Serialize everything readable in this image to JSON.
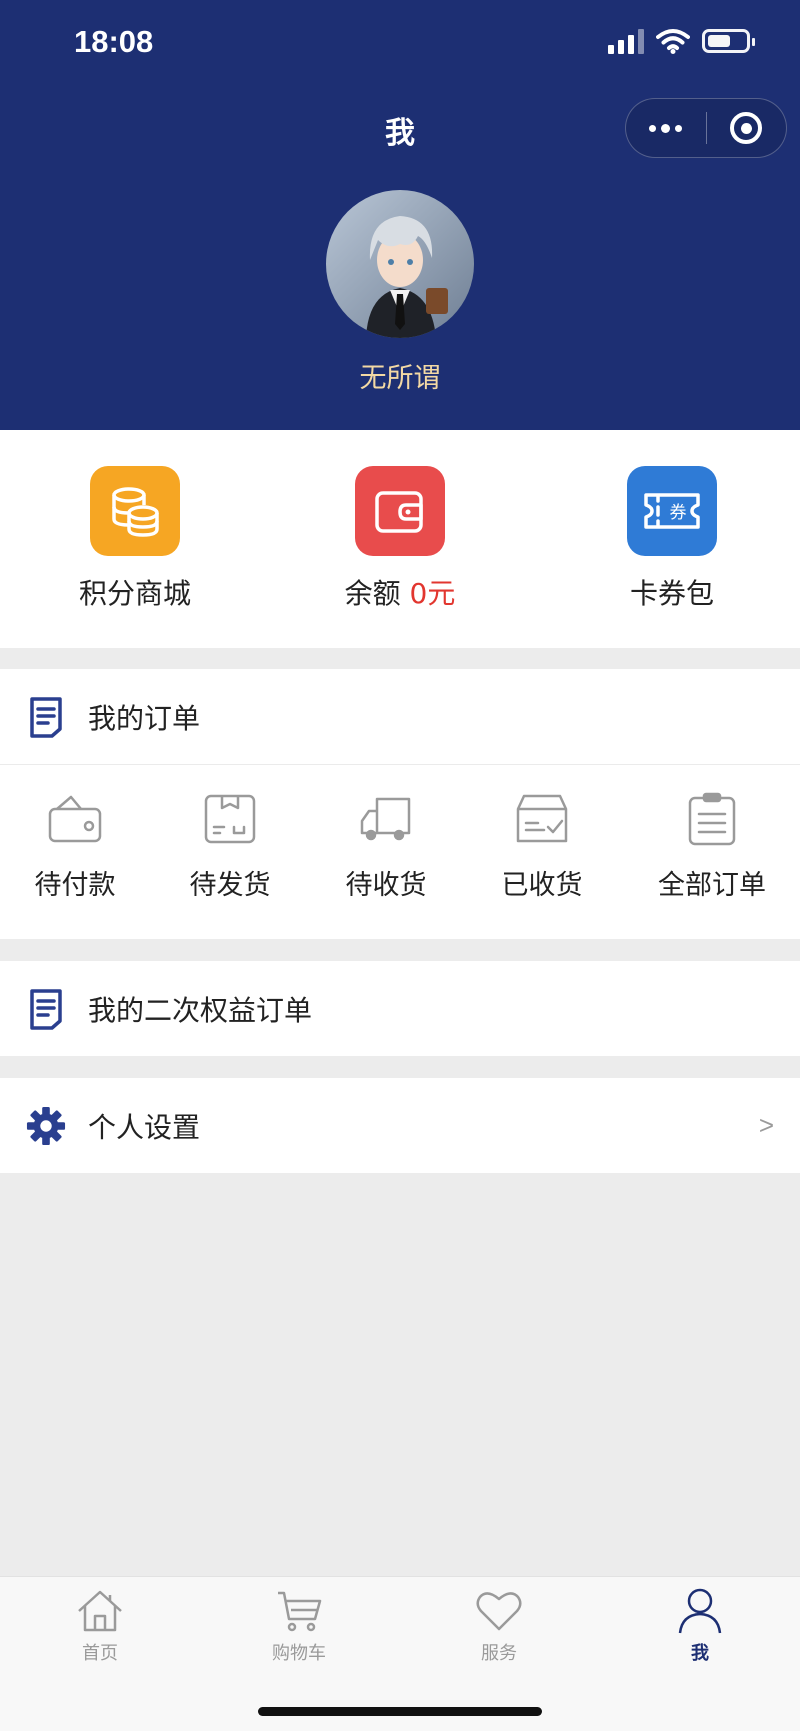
{
  "status_bar": {
    "time": "18:08"
  },
  "header": {
    "title": "我",
    "username": "无所谓"
  },
  "quick_actions": [
    {
      "label": "积分商城",
      "icon": "coins-icon",
      "color": "#f6a623"
    },
    {
      "label": "余额",
      "value": "0元",
      "icon": "wallet-icon",
      "color": "#e84c4c"
    },
    {
      "label": "卡券包",
      "icon": "coupon-icon",
      "color": "#2f7bd6"
    }
  ],
  "orders": {
    "title": "我的订单",
    "items": [
      {
        "label": "待付款",
        "icon": "wallet-outline-icon"
      },
      {
        "label": "待发货",
        "icon": "package-icon"
      },
      {
        "label": "待收货",
        "icon": "truck-icon"
      },
      {
        "label": "已收货",
        "icon": "inbox-check-icon"
      },
      {
        "label": "全部订单",
        "icon": "clipboard-icon"
      }
    ]
  },
  "secondary_orders": {
    "title": "我的二次权益订单"
  },
  "settings": {
    "title": "个人设置",
    "arrow": ">"
  },
  "tabbar": [
    {
      "label": "首页",
      "icon": "home-icon",
      "active": false
    },
    {
      "label": "购物车",
      "icon": "cart-icon",
      "active": false
    },
    {
      "label": "服务",
      "icon": "heart-icon",
      "active": false
    },
    {
      "label": "我",
      "icon": "user-icon",
      "active": true
    }
  ],
  "colors": {
    "header_bg": "#1d2f73",
    "accent_red": "#e2362f",
    "username": "#f3d9a4"
  }
}
